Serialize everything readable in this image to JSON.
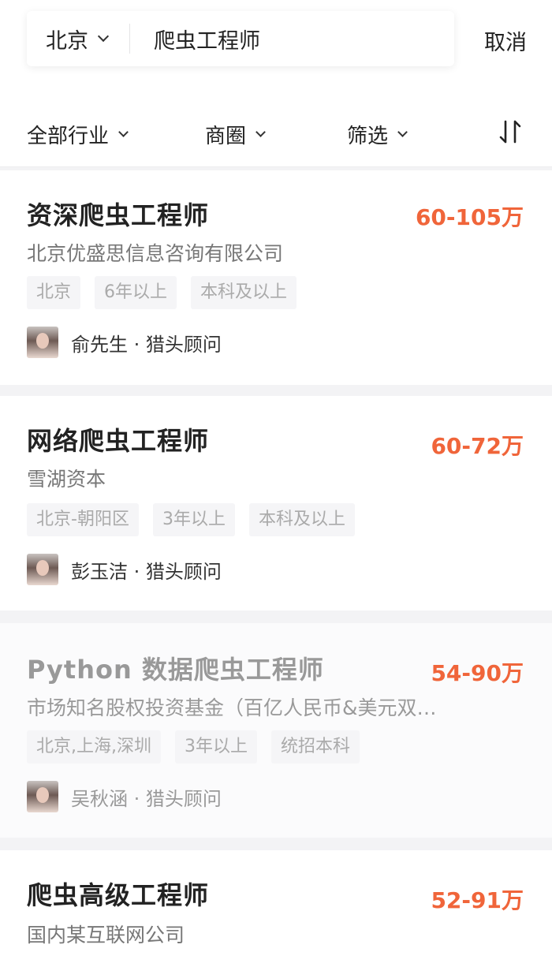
{
  "search": {
    "city": "北京",
    "query": "爬虫工程师",
    "cancel_label": "取消"
  },
  "filters": {
    "industry": "全部行业",
    "area": "商圈",
    "screen": "筛选",
    "sort_icon": "sort-icon"
  },
  "jobs": [
    {
      "title": "资深爬虫工程师",
      "salary": "60-105万",
      "company": "北京优盛思信息咨询有限公司",
      "tags": [
        "北京",
        "6年以上",
        "本科及以上"
      ],
      "recruiter": "俞先生 · 猎头顾问"
    },
    {
      "title": "网络爬虫工程师",
      "salary": "60-72万",
      "company": "雪湖资本",
      "tags": [
        "北京-朝阳区",
        "3年以上",
        "本科及以上"
      ],
      "recruiter": "彭玉洁 · 猎头顾问"
    },
    {
      "title": "Python 数据爬虫工程师",
      "salary": "54-90万",
      "company": "市场知名股权投资基金（百亿人民币&美元双…",
      "tags": [
        "北京,上海,深圳",
        "3年以上",
        "统招本科"
      ],
      "recruiter": "吴秋涵 · 猎头顾问"
    },
    {
      "title": "爬虫高级工程师",
      "salary": "52-91万",
      "company": "国内某互联网公司"
    }
  ],
  "colors": {
    "salary": "#f0653a",
    "background": "#f3f3f5"
  }
}
